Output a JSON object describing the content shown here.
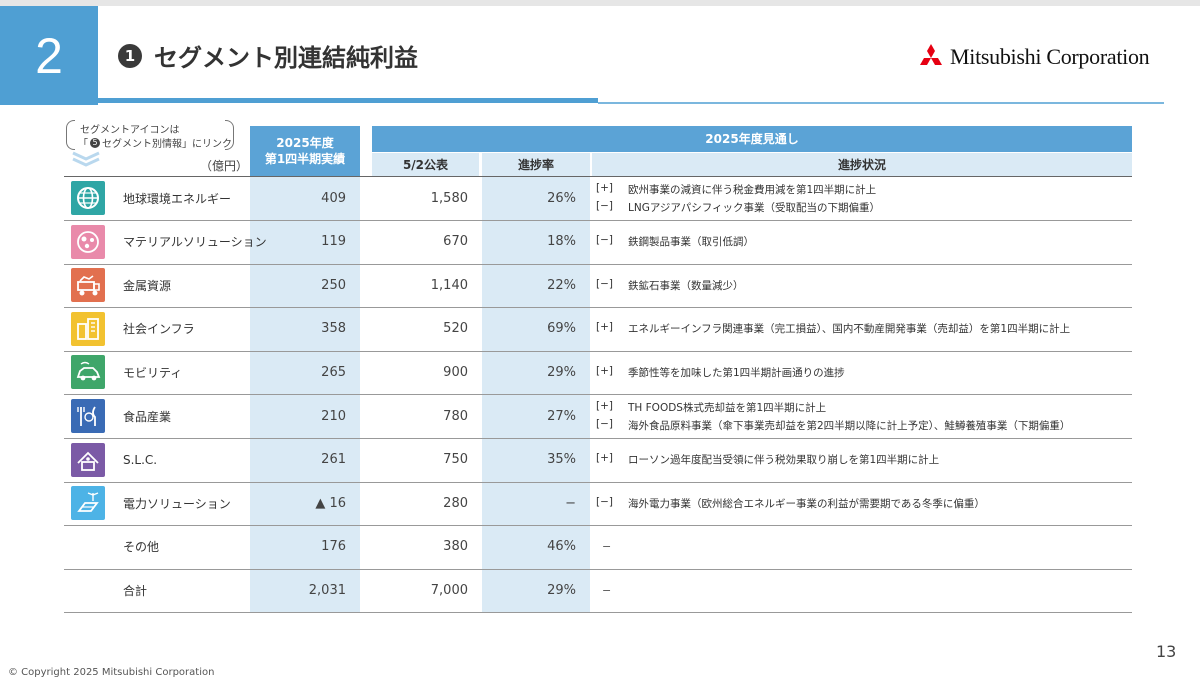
{
  "slide": {
    "section_number": "2",
    "title_marker": "1",
    "title": "セグメント別連結純利益",
    "logo_text": "Mitsubishi Corporation",
    "page_number": "13",
    "copyright": "© Copyright 2025 Mitsubishi Corporation"
  },
  "note": {
    "line1": "セグメントアイコンは",
    "line2_prefix": "「",
    "line2_marker": "5",
    "line2_suffix": " セグメント別情報」にリンク",
    "unit": "（億円）"
  },
  "headers": {
    "actual_l1": "2025年度",
    "actual_l2": "第1四半期実績",
    "forecast_group": "2025年度見通し",
    "announced": "5/2公表",
    "progress_rate": "進捗率",
    "progress_status": "進捗状況"
  },
  "colors": {
    "brand_blue": "#4f9fd3",
    "header_blue": "#5ba3d6",
    "light_blue": "#daeaf5"
  },
  "rows": [
    {
      "name": "地球環境エネルギー",
      "icon": "globe-icon",
      "icon_color": "#2fa6a5",
      "q1": "409",
      "announced": "1,580",
      "rate": "26%",
      "status": [
        {
          "mark": "[+]",
          "text": "欧州事業の減資に伴う税金費用減を第1四半期に計上"
        },
        {
          "mark": "[−]",
          "text": "LNGアジアパシフィック事業（受取配当の下期偏重）"
        }
      ]
    },
    {
      "name": "マテリアルソリューション",
      "icon": "materials-icon",
      "icon_color": "#e98aaa",
      "q1": "119",
      "announced": "670",
      "rate": "18%",
      "status": [
        {
          "mark": "[−]",
          "text": "鉄鋼製品事業（取引低調）"
        }
      ]
    },
    {
      "name": "金属資源",
      "icon": "mining-truck-icon",
      "icon_color": "#e2704f",
      "q1": "250",
      "announced": "1,140",
      "rate": "22%",
      "status": [
        {
          "mark": "[−]",
          "text": "鉄鉱石事業（数量減少）"
        }
      ]
    },
    {
      "name": "社会インフラ",
      "icon": "buildings-icon",
      "icon_color": "#f2c230",
      "q1": "358",
      "announced": "520",
      "rate": "69%",
      "status": [
        {
          "mark": "[+]",
          "text": "エネルギーインフラ関連事業（完工損益）、国内不動産開発事業（売却益）を第1四半期に計上"
        }
      ]
    },
    {
      "name": "モビリティ",
      "icon": "car-icon",
      "icon_color": "#3fa66a",
      "q1": "265",
      "announced": "900",
      "rate": "29%",
      "status": [
        {
          "mark": "[+]",
          "text": "季節性等を加味した第1四半期計画通りの進捗"
        }
      ]
    },
    {
      "name": "食品産業",
      "icon": "food-icon",
      "icon_color": "#3a6bb5",
      "q1": "210",
      "announced": "780",
      "rate": "27%",
      "status": [
        {
          "mark": "[+]",
          "text": "TH FOODS株式売却益を第1四半期に計上"
        },
        {
          "mark": "[−]",
          "text": "海外食品原料事業（傘下事業売却益を第2四半期以降に計上予定）、鮭鱒養殖事業（下期偏重）"
        }
      ]
    },
    {
      "name": "S.L.C.",
      "icon": "lifestyle-icon",
      "icon_color": "#7b5aa6",
      "q1": "261",
      "announced": "750",
      "rate": "35%",
      "status": [
        {
          "mark": "[+]",
          "text": "ローソン過年度配当受領に伴う税効果取り崩しを第1四半期に計上"
        }
      ]
    },
    {
      "name": "電力ソリューション",
      "icon": "solar-wind-icon",
      "icon_color": "#4db3e6",
      "q1": "▲ 16",
      "announced": "280",
      "rate": "−",
      "status": [
        {
          "mark": "[−]",
          "text": "海外電力事業（欧州総合エネルギー事業の利益が需要期である冬季に偏重）"
        }
      ]
    },
    {
      "name": "その他",
      "icon": "",
      "icon_color": "",
      "q1": "176",
      "announced": "380",
      "rate": "46%",
      "status_dash": "−",
      "status": []
    },
    {
      "name": "合計",
      "icon": "",
      "icon_color": "",
      "q1": "2,031",
      "announced": "7,000",
      "rate": "29%",
      "status_dash": "−",
      "status": []
    }
  ]
}
